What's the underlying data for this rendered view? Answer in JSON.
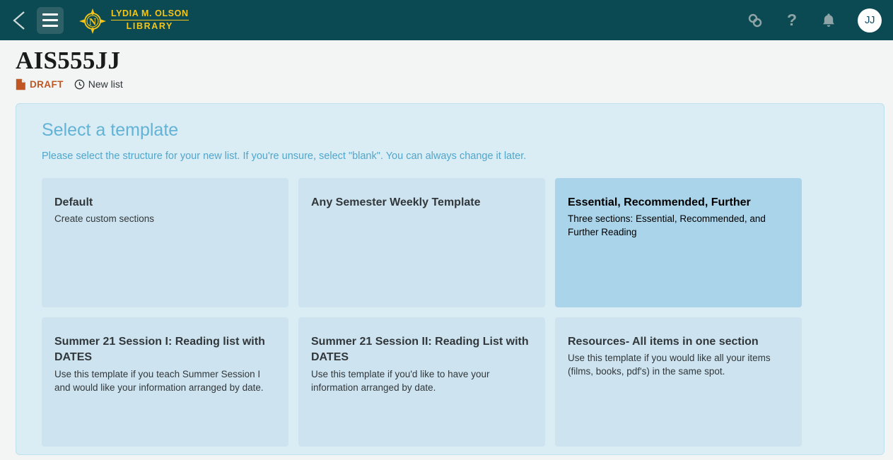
{
  "topbar": {
    "back_icon": "chevron-left-icon",
    "menu_icon": "hamburger-menu-icon",
    "brand_line1": "LYDIA M. OLSON",
    "brand_line2": "LIBRARY",
    "brand_logo_icon": "compass-torch-logo-icon",
    "icons": {
      "link": "link-chain-icon",
      "help": "?",
      "notifications": "bell-icon"
    },
    "avatar_initials": "JJ",
    "background_color": "#0b4a53",
    "accent_color": "#f5c518"
  },
  "list_header": {
    "title": "AIS555JJ",
    "status_label": "DRAFT",
    "status_icon": "document-icon",
    "status_color": "#c05621",
    "type_label": "New list",
    "type_icon": "clock-icon"
  },
  "panel": {
    "title": "Select a template",
    "subtitle": "Please select the structure for your new list. If you're unsure, select \"blank\". You can always change it later.",
    "background_color": "#daecf4",
    "title_color": "#62b3d6",
    "selected_card_color": "#aad4ea",
    "card_color": "#cde4f0",
    "templates": [
      {
        "title": "Default",
        "description": "Create custom sections",
        "selected": false
      },
      {
        "title": "Any Semester Weekly Template",
        "description": "",
        "selected": false
      },
      {
        "title": "Essential, Recommended, Further",
        "description": "Three sections: Essential, Recommended, and Further Reading",
        "selected": true
      },
      {
        "title": "Summer 21 Session I: Reading list with DATES",
        "description": "Use this template if you teach Summer Session I and would like your information arranged by date.",
        "selected": false
      },
      {
        "title": "Summer 21 Session II: Reading List with DATES",
        "description": "Use this template if you'd like to have your information arranged by date.",
        "selected": false
      },
      {
        "title": "Resources- All items in one section",
        "description": "Use this template if you would like all your items (films, books, pdf's) in the same spot.",
        "selected": false
      }
    ]
  }
}
